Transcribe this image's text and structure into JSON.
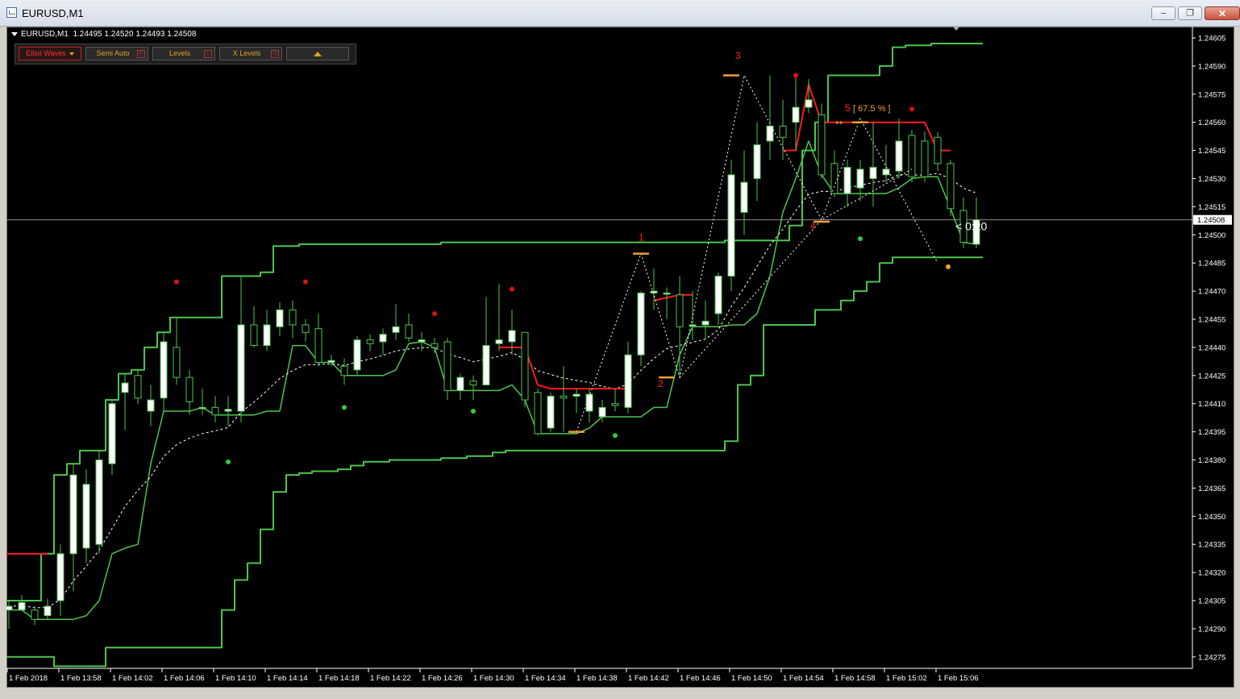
{
  "window": {
    "title": "EURUSD,M1"
  },
  "controls": {
    "minimize": "–",
    "maximize": "❐",
    "close": "✕"
  },
  "chart_info": {
    "symbol": "EURUSD,M1",
    "ohlc": "1.24495 1.24520 1.24493 1.24508"
  },
  "toolbar": {
    "elliot_waves": "Elliot Waves",
    "semi_auto": "Semi Auto",
    "semi_auto_key": "R",
    "levels": "Levels",
    "levels_key": "L",
    "x_levels": "X Levels",
    "x_levels_key": "D"
  },
  "countdown": "< 0:20",
  "wave_labels": [
    "1",
    "2",
    "3",
    "4",
    "5"
  ],
  "fib_label": "[ 67.5 % ]",
  "fib_arrow": "↔",
  "colors": {
    "background": "#000000",
    "bull": "#ffffff",
    "bear": "#000000",
    "channel": "#4dc54d",
    "stop": "#ff1a1a",
    "wave": "#ff2020",
    "level": "#f0a030"
  },
  "chart_data": {
    "type": "candlestick",
    "symbol": "EURUSD",
    "timeframe": "M1",
    "ylim": [
      1.2427,
      1.24615
    ],
    "current_price": "1.24508",
    "y_ticks": [
      "1.24605",
      "1.24590",
      "1.24575",
      "1.24560",
      "1.24545",
      "1.24530",
      "1.24515",
      "1.24500",
      "1.24485",
      "1.24470",
      "1.24455",
      "1.24440",
      "1.24425",
      "1.24410",
      "1.24395",
      "1.24380",
      "1.24365",
      "1.24350",
      "1.24335",
      "1.24320",
      "1.24305",
      "1.24290",
      "1.24275"
    ],
    "x_ticks": [
      "1 Feb 2018",
      "1 Feb 13:58",
      "1 Feb 14:02",
      "1 Feb 14:06",
      "1 Feb 14:10",
      "1 Feb 14:14",
      "1 Feb 14:18",
      "1 Feb 14:22",
      "1 Feb 14:26",
      "1 Feb 14:30",
      "1 Feb 14:34",
      "1 Feb 14:38",
      "1 Feb 14:42",
      "1 Feb 14:46",
      "1 Feb 14:50",
      "1 Feb 14:54",
      "1 Feb 14:58",
      "1 Feb 15:02",
      "1 Feb 15:06"
    ],
    "candles": [
      {
        "o": 1.243,
        "h": 1.24305,
        "l": 1.2429,
        "c": 1.24302
      },
      {
        "o": 1.243,
        "h": 1.24308,
        "l": 1.243,
        "c": 1.24304
      },
      {
        "o": 1.243,
        "h": 1.24302,
        "l": 1.24292,
        "c": 1.24295
      },
      {
        "o": 1.24297,
        "h": 1.24306,
        "l": 1.24295,
        "c": 1.24302
      },
      {
        "o": 1.24305,
        "h": 1.24335,
        "l": 1.24297,
        "c": 1.2433
      },
      {
        "o": 1.2433,
        "h": 1.24378,
        "l": 1.2431,
        "c": 1.24372
      },
      {
        "o": 1.24333,
        "h": 1.24375,
        "l": 1.24325,
        "c": 1.24367
      },
      {
        "o": 1.24335,
        "h": 1.24385,
        "l": 1.2433,
        "c": 1.2438
      },
      {
        "o": 1.24378,
        "h": 1.24412,
        "l": 1.24372,
        "c": 1.2441
      },
      {
        "o": 1.24416,
        "h": 1.24426,
        "l": 1.24396,
        "c": 1.24421
      },
      {
        "o": 1.24425,
        "h": 1.24428,
        "l": 1.2441,
        "c": 1.24413
      },
      {
        "o": 1.24406,
        "h": 1.2442,
        "l": 1.24398,
        "c": 1.24412
      },
      {
        "o": 1.24413,
        "h": 1.24448,
        "l": 1.24405,
        "c": 1.24443
      },
      {
        "o": 1.2444,
        "h": 1.24456,
        "l": 1.2442,
        "c": 1.24424
      },
      {
        "o": 1.24424,
        "h": 1.24428,
        "l": 1.24404,
        "c": 1.24411
      },
      {
        "o": 1.24408,
        "h": 1.24418,
        "l": 1.24404,
        "c": 1.24408
      },
      {
        "o": 1.24408,
        "h": 1.24414,
        "l": 1.244,
        "c": 1.24404
      },
      {
        "o": 1.24406,
        "h": 1.24414,
        "l": 1.24398,
        "c": 1.24407
      },
      {
        "o": 1.24406,
        "h": 1.24478,
        "l": 1.244,
        "c": 1.24452
      },
      {
        "o": 1.24452,
        "h": 1.24462,
        "l": 1.2444,
        "c": 1.24441
      },
      {
        "o": 1.24441,
        "h": 1.2446,
        "l": 1.24438,
        "c": 1.24452
      },
      {
        "o": 1.24451,
        "h": 1.24464,
        "l": 1.24446,
        "c": 1.2446
      },
      {
        "o": 1.2446,
        "h": 1.24465,
        "l": 1.24445,
        "c": 1.24452
      },
      {
        "o": 1.24452,
        "h": 1.24455,
        "l": 1.24443,
        "c": 1.24448
      },
      {
        "o": 1.2445,
        "h": 1.24458,
        "l": 1.2443,
        "c": 1.24432
      },
      {
        "o": 1.24432,
        "h": 1.24436,
        "l": 1.2443,
        "c": 1.24433
      },
      {
        "o": 1.2443,
        "h": 1.24434,
        "l": 1.2442,
        "c": 1.24425
      },
      {
        "o": 1.24428,
        "h": 1.24446,
        "l": 1.24425,
        "c": 1.24444
      },
      {
        "o": 1.24444,
        "h": 1.24447,
        "l": 1.24438,
        "c": 1.24442
      },
      {
        "o": 1.24443,
        "h": 1.2445,
        "l": 1.24436,
        "c": 1.24447
      },
      {
        "o": 1.24448,
        "h": 1.24463,
        "l": 1.24444,
        "c": 1.24451
      },
      {
        "o": 1.24452,
        "h": 1.24458,
        "l": 1.24443,
        "c": 1.24445
      },
      {
        "o": 1.24443,
        "h": 1.24448,
        "l": 1.24438,
        "c": 1.24444
      },
      {
        "o": 1.24442,
        "h": 1.24445,
        "l": 1.24437,
        "c": 1.2444
      },
      {
        "o": 1.24443,
        "h": 1.24445,
        "l": 1.24412,
        "c": 1.24417
      },
      {
        "o": 1.24417,
        "h": 1.24426,
        "l": 1.24412,
        "c": 1.24424
      },
      {
        "o": 1.24422,
        "h": 1.24425,
        "l": 1.24412,
        "c": 1.2442
      },
      {
        "o": 1.2442,
        "h": 1.24467,
        "l": 1.2442,
        "c": 1.24441
      },
      {
        "o": 1.24442,
        "h": 1.24474,
        "l": 1.24438,
        "c": 1.24444
      },
      {
        "o": 1.24443,
        "h": 1.2446,
        "l": 1.24436,
        "c": 1.24449
      },
      {
        "o": 1.24448,
        "h": 1.24448,
        "l": 1.24408,
        "c": 1.24412
      },
      {
        "o": 1.24416,
        "h": 1.24418,
        "l": 1.24393,
        "c": 1.24394
      },
      {
        "o": 1.24397,
        "h": 1.24416,
        "l": 1.24395,
        "c": 1.24414
      },
      {
        "o": 1.24414,
        "h": 1.2443,
        "l": 1.24395,
        "c": 1.24413
      },
      {
        "o": 1.24414,
        "h": 1.24418,
        "l": 1.24405,
        "c": 1.24415
      },
      {
        "o": 1.24406,
        "h": 1.24418,
        "l": 1.244,
        "c": 1.24415
      },
      {
        "o": 1.24403,
        "h": 1.24412,
        "l": 1.244,
        "c": 1.24408
      },
      {
        "o": 1.2441,
        "h": 1.24418,
        "l": 1.24406,
        "c": 1.24409
      },
      {
        "o": 1.24408,
        "h": 1.24443,
        "l": 1.24405,
        "c": 1.24436
      },
      {
        "o": 1.24436,
        "h": 1.2447,
        "l": 1.2443,
        "c": 1.24469
      },
      {
        "o": 1.24469,
        "h": 1.24482,
        "l": 1.2446,
        "c": 1.2447
      },
      {
        "o": 1.24469,
        "h": 1.24472,
        "l": 1.24455,
        "c": 1.24469
      },
      {
        "o": 1.24468,
        "h": 1.24478,
        "l": 1.24424,
        "c": 1.24451
      },
      {
        "o": 1.24452,
        "h": 1.2447,
        "l": 1.24444,
        "c": 1.24452
      },
      {
        "o": 1.24452,
        "h": 1.24465,
        "l": 1.24444,
        "c": 1.24454
      },
      {
        "o": 1.24458,
        "h": 1.2448,
        "l": 1.24452,
        "c": 1.24478
      },
      {
        "o": 1.24478,
        "h": 1.2454,
        "l": 1.2447,
        "c": 1.24532
      },
      {
        "o": 1.24512,
        "h": 1.24545,
        "l": 1.245,
        "c": 1.24528
      },
      {
        "o": 1.2453,
        "h": 1.2456,
        "l": 1.24518,
        "c": 1.24548
      },
      {
        "o": 1.2455,
        "h": 1.24585,
        "l": 1.2454,
        "c": 1.24558
      },
      {
        "o": 1.24558,
        "h": 1.24572,
        "l": 1.2454,
        "c": 1.24552
      },
      {
        "o": 1.2456,
        "h": 1.24585,
        "l": 1.24545,
        "c": 1.24568
      },
      {
        "o": 1.24568,
        "h": 1.24583,
        "l": 1.24565,
        "c": 1.24572
      },
      {
        "o": 1.24564,
        "h": 1.2457,
        "l": 1.2453,
        "c": 1.24532
      },
      {
        "o": 1.24538,
        "h": 1.24545,
        "l": 1.2452,
        "c": 1.24522
      },
      {
        "o": 1.24522,
        "h": 1.2454,
        "l": 1.24515,
        "c": 1.24536
      },
      {
        "o": 1.24525,
        "h": 1.2454,
        "l": 1.24518,
        "c": 1.24535
      },
      {
        "o": 1.2453,
        "h": 1.2456,
        "l": 1.24515,
        "c": 1.24536
      },
      {
        "o": 1.24532,
        "h": 1.24548,
        "l": 1.24528,
        "c": 1.24535
      },
      {
        "o": 1.24534,
        "h": 1.24562,
        "l": 1.2453,
        "c": 1.2455
      },
      {
        "o": 1.24553,
        "h": 1.24556,
        "l": 1.24528,
        "c": 1.24531
      },
      {
        "o": 1.2455,
        "h": 1.24555,
        "l": 1.24528,
        "c": 1.24531
      },
      {
        "o": 1.24552,
        "h": 1.24555,
        "l": 1.24534,
        "c": 1.24538
      },
      {
        "o": 1.24538,
        "h": 1.2454,
        "l": 1.2451,
        "c": 1.24514
      },
      {
        "o": 1.24513,
        "h": 1.2452,
        "l": 1.24493,
        "c": 1.24496
      },
      {
        "o": 1.24495,
        "h": 1.2452,
        "l": 1.24493,
        "c": 1.24508
      }
    ],
    "channel_upper": [
      1.24305,
      1.24305,
      1.24305,
      1.2433,
      1.24372,
      1.24378,
      1.24385,
      1.24385,
      1.24412,
      1.24426,
      1.24428,
      1.2444,
      1.24448,
      1.24456,
      1.24456,
      1.24456,
      1.24456,
      1.24478,
      1.24478,
      1.24478,
      1.2448,
      1.24494,
      1.24494,
      1.24495,
      1.24495,
      1.24495,
      1.24495,
      1.24495,
      1.24495,
      1.24495,
      1.24495,
      1.24495,
      1.24495,
      1.24495,
      1.24496,
      1.24496,
      1.24496,
      1.24496,
      1.24496,
      1.24496,
      1.24496,
      1.24496,
      1.24496,
      1.24496,
      1.24496,
      1.24496,
      1.24496,
      1.24496,
      1.24496,
      1.24496,
      1.24496,
      1.24496,
      1.24496,
      1.24496,
      1.24496,
      1.24496,
      1.24497,
      1.24497,
      1.24497,
      1.24497,
      1.24497,
      1.24505,
      1.24545,
      1.2456,
      1.24585,
      1.24585,
      1.24585,
      1.24585,
      1.2459,
      1.246,
      1.24601,
      1.24601,
      1.24602,
      1.24602,
      1.24602,
      1.24602
    ],
    "channel_lower": [
      1.24275,
      1.24275,
      1.24275,
      1.24275,
      1.2427,
      1.2427,
      1.2427,
      1.2427,
      1.2428,
      1.2428,
      1.2428,
      1.2428,
      1.2428,
      1.2428,
      1.2428,
      1.2428,
      1.2428,
      1.243,
      1.24316,
      1.24325,
      1.24343,
      1.24363,
      1.24372,
      1.24373,
      1.24374,
      1.24374,
      1.24375,
      1.24377,
      1.24379,
      1.24379,
      1.2438,
      1.2438,
      1.2438,
      1.2438,
      1.24381,
      1.24381,
      1.24382,
      1.24382,
      1.24384,
      1.24385,
      1.24385,
      1.24385,
      1.24385,
      1.24385,
      1.24385,
      1.24385,
      1.24385,
      1.24385,
      1.24385,
      1.24385,
      1.24385,
      1.24385,
      1.24385,
      1.24385,
      1.24385,
      1.24385,
      1.2439,
      1.2442,
      1.24425,
      1.24452,
      1.24452,
      1.24452,
      1.24452,
      1.2446,
      1.2446,
      1.24465,
      1.2447,
      1.24475,
      1.24485,
      1.24488,
      1.24488,
      1.24488,
      1.24488,
      1.24488,
      1.24488,
      1.24488
    ],
    "stop_line": {
      "start_index": 38,
      "values": [
        1.2444,
        1.2444,
        1.2444,
        1.2442,
        1.24418,
        1.24418,
        1.24418,
        1.24418,
        1.24418,
        1.24418,
        1.24418
      ]
    }
  }
}
